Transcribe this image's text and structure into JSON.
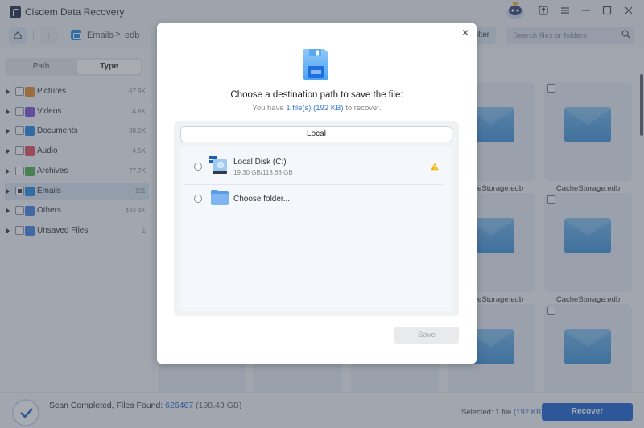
{
  "app": {
    "title": "Cisdem Data Recovery"
  },
  "window_controls": {
    "mascot_icon": "mascot-icon",
    "upgrade_icon": "upgrade-icon",
    "menu_icon": "menu-icon",
    "minimize_icon": "minimize-icon",
    "maximize_icon": "maximize-icon",
    "close_icon": "close-icon"
  },
  "toolbar": {
    "breadcrumb": [
      "Emails",
      "edb"
    ],
    "breadcrumb_separator": ">",
    "filter_label": "Filter",
    "search_placeholder": "Search files or folders"
  },
  "sidebar": {
    "tabs": [
      {
        "label": "Path",
        "active": false
      },
      {
        "label": "Type",
        "active": true
      }
    ],
    "items": [
      {
        "label": "Pictures",
        "count": "67.9K",
        "icon": "pictures-icon",
        "color": "#e8892b",
        "selected": false
      },
      {
        "label": "Videos",
        "count": "4.8K",
        "icon": "videos-icon",
        "color": "#7b4fd8",
        "selected": false
      },
      {
        "label": "Documents",
        "count": "38.0K",
        "icon": "documents-icon",
        "color": "#1e88e5",
        "selected": false
      },
      {
        "label": "Audio",
        "count": "4.5K",
        "icon": "audio-icon",
        "color": "#e04b5a",
        "selected": false
      },
      {
        "label": "Archives",
        "count": "77.7K",
        "icon": "archives-icon",
        "color": "#4caf50",
        "selected": false
      },
      {
        "label": "Emails",
        "count": "191",
        "icon": "emails-icon",
        "color": "#1e88e5",
        "selected": true
      },
      {
        "label": "Others",
        "count": "433.4K",
        "icon": "others-icon",
        "color": "#3d7fe0",
        "selected": false
      },
      {
        "label": "Unsaved Files",
        "count": "1",
        "icon": "unsaved-files-icon",
        "color": "#3d7fe0",
        "selected": false
      }
    ]
  },
  "grid": {
    "files": [
      {
        "name": "CacheStorage.edb"
      },
      {
        "name": "CacheStorage.edb"
      },
      {
        "name": "CacheStorage.edb"
      },
      {
        "name": "CacheStorage.edb"
      }
    ]
  },
  "dialog": {
    "title": "Choose a destination path to save the file:",
    "subtitle_prefix": "You have ",
    "subtitle_highlight": "1 file(s) (192 KB)",
    "subtitle_suffix": " to recover.",
    "tab_label": "Local",
    "destinations": [
      {
        "name": "Local Disk (C:)",
        "size": "19.30 GB/118.68 GB",
        "icon": "local-disk-icon",
        "warning": true
      },
      {
        "name": "Choose folder...",
        "icon": "folder-icon",
        "warning": false
      }
    ],
    "save_label": "Save"
  },
  "statusbar": {
    "scan_label": "Scan Completed, Files Found: ",
    "files_found": "626467",
    "total_size": "(198.43 GB)",
    "selected_label": "Selected: 1 file ",
    "selected_size": "(192 KB)",
    "recover_label": "Recover"
  },
  "colors": {
    "accent": "#1a5fd0",
    "link": "#3a7bd5",
    "warning": "#f5b400"
  }
}
